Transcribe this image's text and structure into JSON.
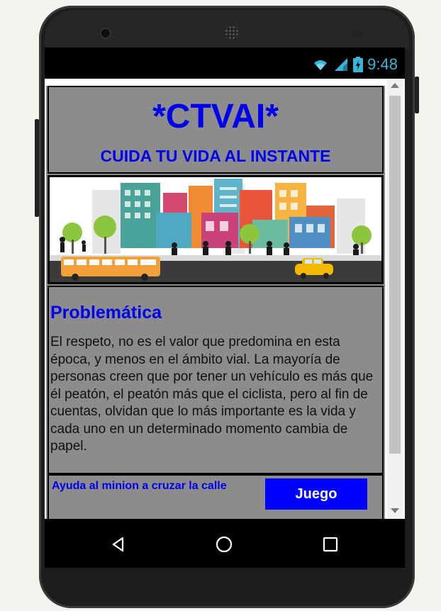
{
  "status": {
    "time": "9:48",
    "icons": [
      "wifi-icon",
      "signal-icon",
      "battery-icon"
    ],
    "accent": "#35b6d6"
  },
  "header": {
    "title": "*CTVAI*",
    "subtitle": "CUIDA TU VIDA AL INSTANTE"
  },
  "banner": {
    "image": "city-street-illustration"
  },
  "problem": {
    "title": "Problemática",
    "body": "El respeto, no es el valor que predomina en esta época, y menos en el ámbito vial. La mayoría de personas creen que por tener un vehículo es más que él peatón, el peatón más que el ciclista, pero al fin de cuentas, olvidan que lo más importante es la vida y cada uno en un determinado momento cambia de papel."
  },
  "footer": {
    "help_text": "Ayuda al minion a cruzar la calle",
    "game_button": "Juego"
  },
  "navigation": {
    "buttons": [
      "back-icon",
      "home-icon",
      "recents-icon"
    ]
  },
  "colors": {
    "text_blue": "#0000ee",
    "button_blue": "#0000ff",
    "panel_gray": "#8c8c8c"
  }
}
